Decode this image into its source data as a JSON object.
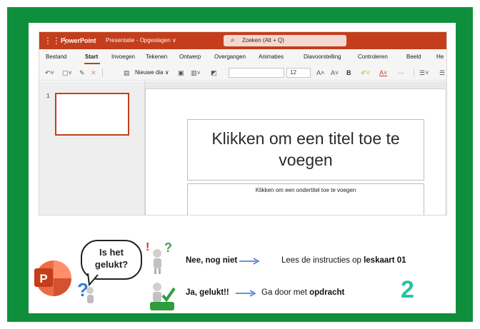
{
  "titlebar": {
    "app_name": "PowerPoint",
    "document": "Presentatie - Opgeslagen ∨",
    "search_placeholder": "Zoeken (Alt + Q)"
  },
  "ribbon_tabs": [
    "Bestand",
    "Start",
    "Invoegen",
    "Tekenen",
    "Ontwerp",
    "Overgangen",
    "Animaties",
    "Diavoorstelling",
    "Controleren",
    "Beeld",
    "He"
  ],
  "toolbar": {
    "new_slide": "Nieuwe dia ∨",
    "font_size": "12",
    "grow_font": "A˄",
    "shrink_font": "A˅",
    "bold": "B",
    "more": "···"
  },
  "slide_pane": {
    "slide_number": "1"
  },
  "slide": {
    "title_placeholder": "Klikken om een titel toe te voegen",
    "subtitle_placeholder": "Klikken om een ondertitel toe te voegen"
  },
  "bubble": {
    "text": "Is het gelukt?"
  },
  "rows": {
    "no": {
      "label": "Nee, nog niet",
      "text": "Lees de instructies op ",
      "strong": "leskaart 01"
    },
    "yes": {
      "label": "Ja, gelukt!!",
      "text": "Ga door met ",
      "strong": "opdracht",
      "number": "2"
    }
  },
  "colors": {
    "frame": "#0f8f3c",
    "powerpoint": "#c43e1c",
    "arrow": "#3a6fd0",
    "number": "#25c4a0"
  }
}
